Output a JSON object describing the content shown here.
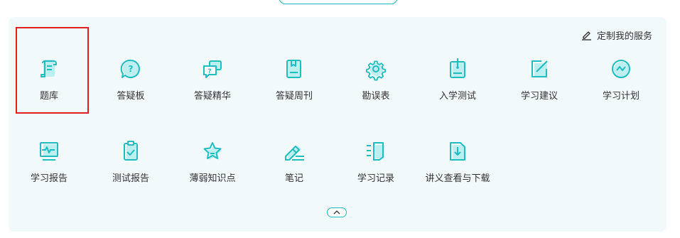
{
  "header": {
    "customize_label": "定制我的服务"
  },
  "colors": {
    "accent": "#1fbcc0",
    "accent_light": "#7fe3e6",
    "highlight": "#e02020",
    "panel": "#f1f9fa"
  },
  "row1": [
    {
      "label": "题库",
      "icon": "question-bank-icon"
    },
    {
      "label": "答疑板",
      "icon": "question-bubble-icon"
    },
    {
      "label": "答疑精华",
      "icon": "chat-bubbles-icon"
    },
    {
      "label": "答疑周刊",
      "icon": "bookmark-book-icon"
    },
    {
      "label": "勘误表",
      "icon": "gear-icon"
    },
    {
      "label": "入学测试",
      "icon": "entrance-test-icon"
    },
    {
      "label": "学习建议",
      "icon": "edit-square-icon"
    },
    {
      "label": "学习计划",
      "icon": "trend-circle-icon"
    }
  ],
  "row2": [
    {
      "label": "学习报告",
      "icon": "pulse-monitor-icon"
    },
    {
      "label": "测试报告",
      "icon": "clipboard-check-icon"
    },
    {
      "label": "薄弱知识点",
      "icon": "star-icon"
    },
    {
      "label": "笔记",
      "icon": "pencil-note-icon"
    },
    {
      "label": "学习记录",
      "icon": "record-list-icon"
    },
    {
      "label": "讲义查看与下载",
      "icon": "download-doc-icon"
    }
  ]
}
